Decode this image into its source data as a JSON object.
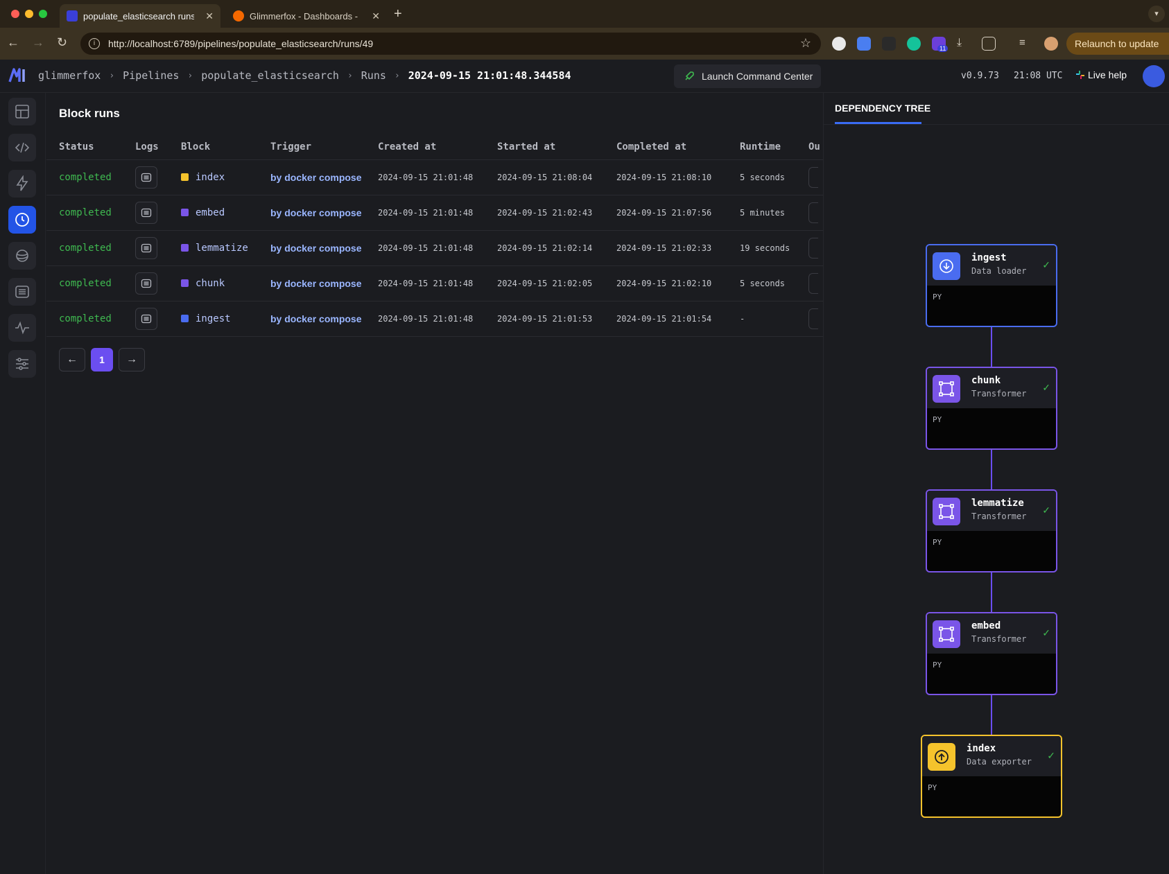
{
  "browser": {
    "tabs": [
      {
        "title": "populate_elasticsearch runs |",
        "active": true
      },
      {
        "title": "Glimmerfox - Dashboards - G",
        "active": false
      }
    ],
    "url": "http://localhost:6789/pipelines/populate_elasticsearch/runs/49",
    "relaunch_label": "Relaunch to update",
    "extension_badge": "11"
  },
  "header": {
    "breadcrumbs": [
      "glimmerfox",
      "Pipelines",
      "populate_elasticsearch",
      "Runs"
    ],
    "current": "2024-09-15 21:01:48.344584",
    "launch_label": "Launch Command Center",
    "version": "v0.9.73",
    "time": "21:08 UTC",
    "live_help": "Live help"
  },
  "main": {
    "title": "Block runs",
    "columns": [
      "Status",
      "Logs",
      "Block",
      "Trigger",
      "Created at",
      "Started at",
      "Completed at",
      "Runtime",
      "Ou"
    ],
    "rows": [
      {
        "status": "completed",
        "block": "index",
        "color": "#f5c32c",
        "trigger": "by docker compose",
        "created": "2024-09-15 21:01:48",
        "started": "2024-09-15 21:08:04",
        "completed": "2024-09-15 21:08:10",
        "runtime": "5 seconds"
      },
      {
        "status": "completed",
        "block": "embed",
        "color": "#7a55e8",
        "trigger": "by docker compose",
        "created": "2024-09-15 21:01:48",
        "started": "2024-09-15 21:02:43",
        "completed": "2024-09-15 21:07:56",
        "runtime": "5 minutes"
      },
      {
        "status": "completed",
        "block": "lemmatize",
        "color": "#7a55e8",
        "trigger": "by docker compose",
        "created": "2024-09-15 21:01:48",
        "started": "2024-09-15 21:02:14",
        "completed": "2024-09-15 21:02:33",
        "runtime": "19 seconds"
      },
      {
        "status": "completed",
        "block": "chunk",
        "color": "#7a55e8",
        "trigger": "by docker compose",
        "created": "2024-09-15 21:01:48",
        "started": "2024-09-15 21:02:05",
        "completed": "2024-09-15 21:02:10",
        "runtime": "5 seconds"
      },
      {
        "status": "completed",
        "block": "ingest",
        "color": "#4a6cf0",
        "trigger": "by docker compose",
        "created": "2024-09-15 21:01:48",
        "started": "2024-09-15 21:01:53",
        "completed": "2024-09-15 21:01:54",
        "runtime": "-"
      }
    ],
    "pagination": {
      "current_page": "1"
    }
  },
  "dependency_tree": {
    "tab_label": "DEPENDENCY TREE",
    "nodes": [
      {
        "name": "ingest",
        "type": "Data loader",
        "lang": "PY",
        "color": "#4a6cf0",
        "icon": "download-icon"
      },
      {
        "name": "chunk",
        "type": "Transformer",
        "lang": "PY",
        "color": "#7a55e8",
        "icon": "transform-icon"
      },
      {
        "name": "lemmatize",
        "type": "Transformer",
        "lang": "PY",
        "color": "#7a55e8",
        "icon": "transform-icon"
      },
      {
        "name": "embed",
        "type": "Transformer",
        "lang": "PY",
        "color": "#7a55e8",
        "icon": "transform-icon"
      },
      {
        "name": "index",
        "type": "Data exporter",
        "lang": "PY",
        "color": "#f5c32c",
        "icon": "upload-icon"
      }
    ]
  }
}
